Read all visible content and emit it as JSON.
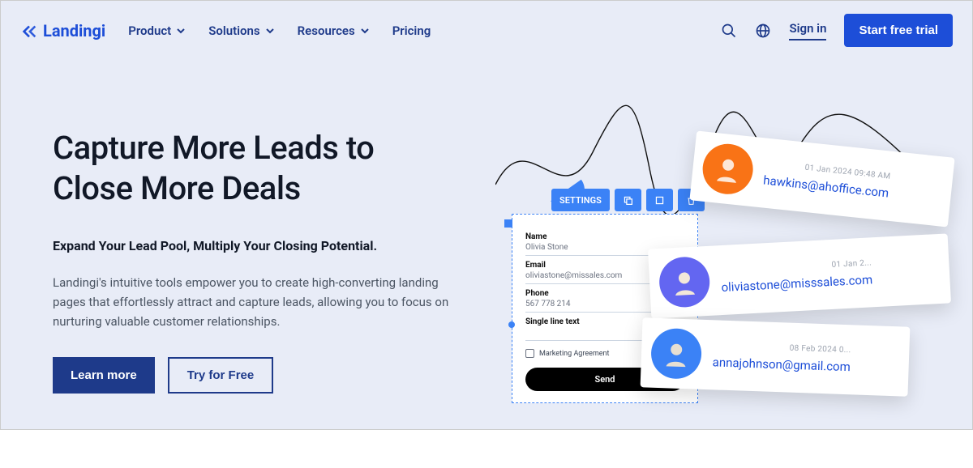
{
  "brand": "Landingi",
  "nav": {
    "items": [
      "Product",
      "Solutions",
      "Resources",
      "Pricing"
    ],
    "signin": "Sign in",
    "trial": "Start free trial"
  },
  "hero": {
    "title_l1": "Capture More Leads to",
    "title_l2": "Close More Deals",
    "subtitle": "Expand Your Lead Pool, Multiply Your Closing Potential.",
    "body": "Landingi's intuitive tools empower you to create high-converting landing pages that effortlessly attract and capture leads, allowing you to focus on nurturing valuable customer relationships.",
    "cta_primary": "Learn more",
    "cta_secondary": "Try for Free"
  },
  "editor": {
    "toolbar_settings": "SETTINGS",
    "form": {
      "name_label": "Name",
      "name_value": "Olivia Stone",
      "email_label": "Email",
      "email_value": "oliviastone@missales.com",
      "phone_label": "Phone",
      "phone_value": "567 778 214",
      "single_line_label": "Single line text",
      "agreement_label": "Marketing Agreement",
      "send": "Send"
    }
  },
  "leads": [
    {
      "timestamp": "01 Jan 2024 09:48 AM",
      "email": "hawkins@ahoffice.com"
    },
    {
      "timestamp": "01 Jan 2...",
      "email": "oliviastone@misssales.com"
    },
    {
      "timestamp": "08 Feb 2024 0...",
      "email": "annajohnson@gmail.com"
    }
  ]
}
